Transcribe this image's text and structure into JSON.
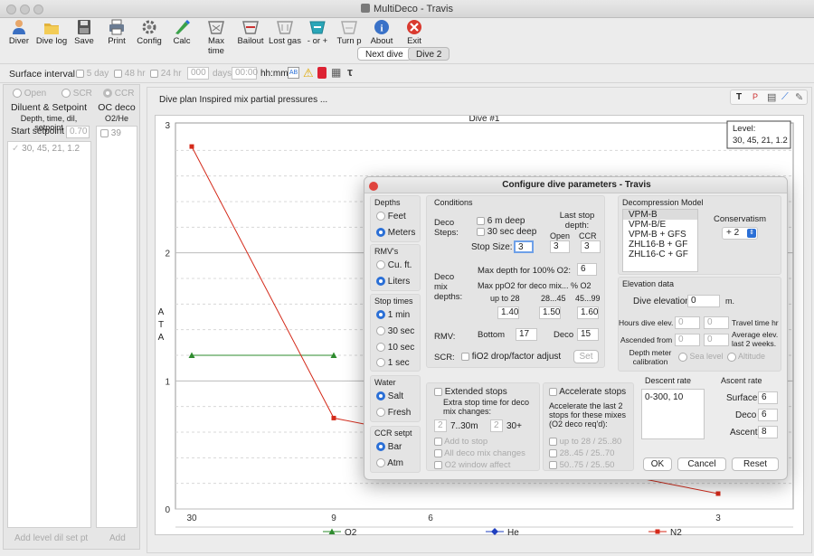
{
  "window": {
    "title": "MultiDeco - Travis"
  },
  "toolbar": {
    "items": [
      {
        "label": "Diver",
        "icon": "diver-icon"
      },
      {
        "label": "Dive log",
        "icon": "dive-log-icon"
      },
      {
        "label": "Save",
        "icon": "save-icon"
      },
      {
        "label": "Print",
        "icon": "print-icon"
      },
      {
        "label": "Config",
        "icon": "config-icon"
      },
      {
        "label": "Calc",
        "icon": "calc-icon"
      },
      {
        "label": "Max time",
        "icon": "max-time-icon"
      },
      {
        "label": "Bailout",
        "icon": "bailout-icon"
      },
      {
        "label": "Lost gas",
        "icon": "lost-gas-icon"
      },
      {
        "label": "- or +",
        "icon": "minus-plus-icon"
      },
      {
        "label": "Turn p",
        "icon": "turn-point-icon"
      },
      {
        "label": "About",
        "icon": "info-icon"
      },
      {
        "label": "Exit",
        "icon": "exit-icon"
      }
    ]
  },
  "tabs": [
    "Next dive",
    "Dive 2"
  ],
  "surface": {
    "label": "Surface interval",
    "opt1": "5 day",
    "opt2": "48 hr",
    "opt3": "24 hr",
    "days_value": "000",
    "days_label": "days",
    "time_value": "00:00",
    "time_label": "hh:mm"
  },
  "left": {
    "mode_open": "Open",
    "mode_scr": "SCR",
    "mode_ccr": "CCR",
    "dil_header": "Diluent & Setpoint",
    "dil_sub": "Depth, time, dil, setpoint",
    "start_setpoint_label": "Start setpoint",
    "start_setpoint_value": "0.70",
    "dil_row": "30, 45, 21, 1.2",
    "oc_header": "OC deco",
    "oc_sub": "O2/He",
    "oc_row": "39",
    "add_dil_button": "Add level dil set pt",
    "add_oc_button": "Add"
  },
  "plot": {
    "caption": "Dive plan Inspired mix partial pressures ...",
    "level_label": "Level:",
    "level_value": "30, 45, 21, 1.2"
  },
  "chart_data": {
    "type": "line",
    "title": "Dive #1",
    "ylabel": "ATA",
    "x_tick_labels": [
      "30",
      "9",
      "6",
      "3"
    ],
    "y_ticks": [
      "0",
      "1",
      "2",
      "3"
    ],
    "ylim": [
      0,
      3
    ],
    "grid": true,
    "legend_placement": "bottom",
    "series": [
      {
        "name": "O2",
        "color": "#2e8b2e",
        "marker": "triangle",
        "points": [
          [
            0,
            1.2
          ],
          [
            1,
            1.2
          ]
        ]
      },
      {
        "name": "He",
        "color": "#1f3fbf",
        "marker": "diamond",
        "points": []
      },
      {
        "name": "N2",
        "color": "#d42a1a",
        "marker": "square",
        "points": [
          [
            0,
            2.83
          ],
          [
            1,
            0.71
          ],
          [
            3,
            0.12
          ]
        ]
      }
    ]
  },
  "dialog": {
    "title": "Configure dive parameters - Travis",
    "depths_label": "Depths",
    "feet": "Feet",
    "meters": "Meters",
    "rmvs_label": "RMV's",
    "cuft": "Cu. ft.",
    "liters": "Liters",
    "stoptimes_label": "Stop times",
    "st1": "1 min",
    "st30": "30 sec",
    "st10": "10 sec",
    "st1s": "1 sec",
    "water_label": "Water",
    "salt": "Salt",
    "fresh": "Fresh",
    "ccr_label": "CCR setpt",
    "bar": "Bar",
    "atm": "Atm",
    "conditions_label": "Conditions",
    "deco_steps_label": "Deco Steps:",
    "six_m_deep": "6 m deep",
    "thirty_sec_deep": "30 sec deep",
    "last_stop_label": "Last stop depth:",
    "open_label": "Open",
    "ccr_col_label": "CCR",
    "stop_size_label": "Stop Size:",
    "stop_size_value": "3",
    "open_value": "3",
    "ccr_value": "3",
    "deco_mix_label": "Deco mix depths:",
    "max_depth_o2_label": "Max depth for 100% O2:",
    "max_depth_o2_value": "6",
    "max_ppo2_label": "Max ppO2 for deco mix... % O2",
    "upto28": "up to 28",
    "r2845": "28...45",
    "r4599": "45...99",
    "ppo2_a": "1.40",
    "ppo2_b": "1.50",
    "ppo2_c": "1.60",
    "rmv_label": "RMV:",
    "bottom_label": "Bottom",
    "bottom_value": "17",
    "deco_label": "Deco",
    "deco_value": "15",
    "scr_label": "SCR:",
    "fio2_label": "fiO2 drop/factor adjust",
    "set_button": "Set",
    "extended_stops": "Extended stops",
    "extra_stop_text": "Extra stop time for deco mix changes:",
    "ext_a": "2",
    "ext_range": "7..30m",
    "ext_b": "2",
    "ext_30": "30+",
    "add_to_stop": "Add to stop",
    "all_deco_mix": "All deco mix changes",
    "o2_window": "O2 window affect",
    "accelerate_stops": "Accelerate stops",
    "accelerate_text": "Accelerate the last 2 stops for these mixes (O2 deco req'd):",
    "acc1": "up to 28 / 25..80",
    "acc2": "28..45 / 25..70",
    "acc3": "50..75 / 25..50",
    "decomodel_label": "Decompression Model",
    "models": [
      "VPM-B",
      "VPM-B/E",
      "VPM-B + GFS",
      "ZHL16-B + GF",
      "ZHL16-C + GF"
    ],
    "conservatism_label": "Conservatism",
    "conservatism_value": "+ 2",
    "elevation_label": "Elevation data",
    "dive_elevation_label": "Dive elevation",
    "dive_elevation_value": "0",
    "elevation_unit": "m.",
    "hours_dive_elev": "Hours dive elev.",
    "hde_a": "0",
    "hde_b": "0",
    "travel_time": "Travel time hr",
    "ascended_from": "Ascended from",
    "af_a": "0",
    "af_b": "0",
    "avg_elev": "Average elev. last 2 weeks.",
    "depth_meter_cal": "Depth meter calibration",
    "sea_level": "Sea level",
    "altitude": "Altitude",
    "descent_label": "Descent rate",
    "descent_value": "0-300, 10",
    "ascent_label": "Ascent rate",
    "surface_label": "Surface",
    "surface_value": "6",
    "deco_rate_label": "Deco",
    "deco_rate_value": "6",
    "ascent_rate_label": "Ascent",
    "ascent_rate_value": "8",
    "ok": "OK",
    "cancel": "Cancel",
    "reset": "Reset"
  },
  "colors": {
    "accent": "#2a6fd6",
    "close_red": "#e0443e",
    "o2": "#2e8b2e",
    "he": "#1f3fbf",
    "n2": "#d42a1a"
  }
}
